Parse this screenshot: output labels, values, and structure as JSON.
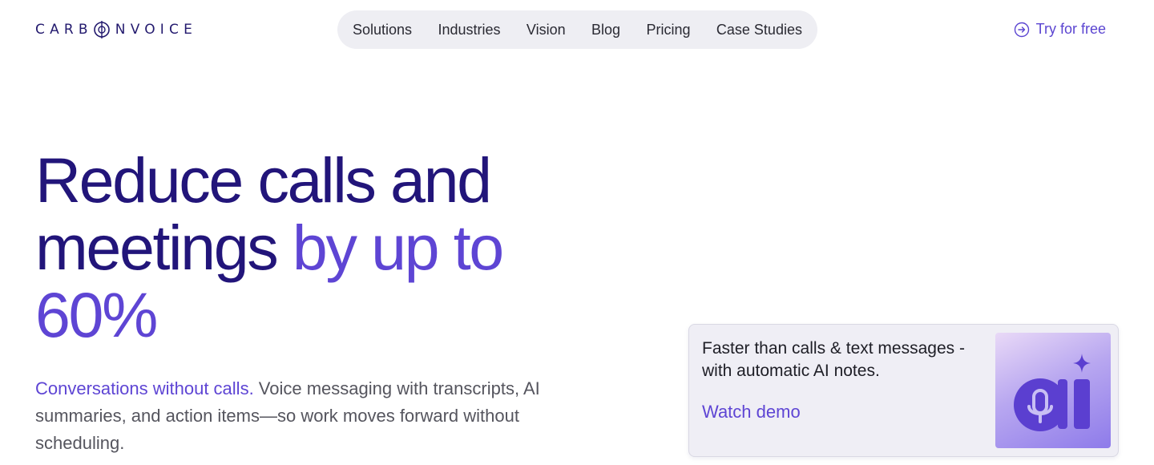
{
  "header": {
    "logo_text_left": "CARB",
    "logo_text_right": "NVOICE",
    "nav": [
      "Solutions",
      "Industries",
      "Vision",
      "Blog",
      "Pricing",
      "Case Studies"
    ],
    "cta_label": "Try for free"
  },
  "hero": {
    "title_line1": "Reduce calls and",
    "title_line2_dark": "meetings ",
    "title_line2_accent": "by up to",
    "title_line3_accent": "60%",
    "subtitle_link": "Conversations without calls.",
    "subtitle_rest": " Voice messaging with transcripts, AI summaries, and action items—so work moves forward without scheduling."
  },
  "card": {
    "text": "Faster than calls & text messages - with automatic AI notes.",
    "link_label": "Watch demo",
    "thumbnail_icon": "ai-mic-icon"
  },
  "colors": {
    "brand_dark": "#22157a",
    "accent": "#5e45d4"
  }
}
